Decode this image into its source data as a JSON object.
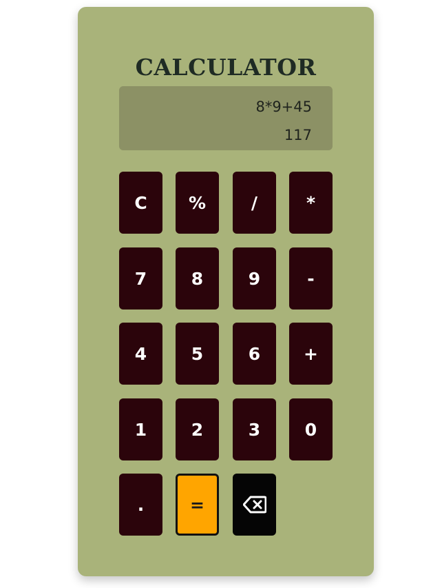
{
  "title": "CALCULATOR",
  "display": {
    "expression": "8*9+45",
    "result": "117"
  },
  "keys": {
    "clear": "C",
    "percent": "%",
    "divide": "/",
    "multiply": "*",
    "seven": "7",
    "eight": "8",
    "nine": "9",
    "minus": "-",
    "four": "4",
    "five": "5",
    "six": "6",
    "plus": "+",
    "one": "1",
    "two": "2",
    "three": "3",
    "zero": "0",
    "dot": ".",
    "equals": "="
  },
  "icons": {
    "backspace": "backspace-icon"
  },
  "colors": {
    "panel": "#a9b37a",
    "display": "#8c9165",
    "key": "#2b040b",
    "equals": "#ffa500",
    "backspace": "#050505"
  }
}
